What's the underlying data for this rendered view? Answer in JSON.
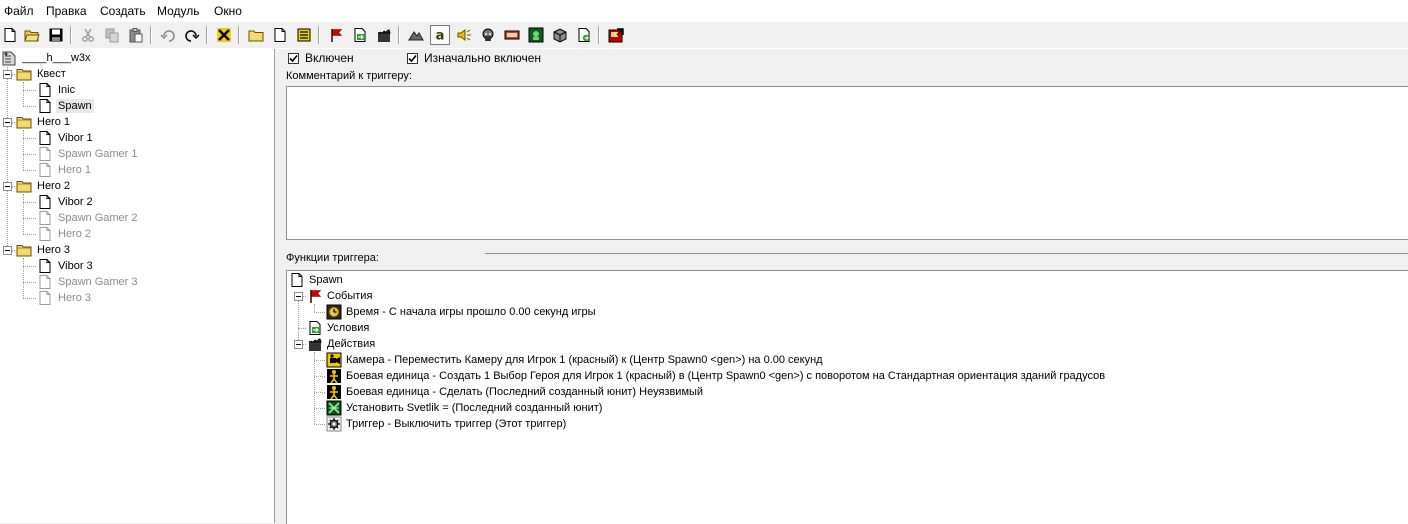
{
  "menu": [
    "Файл",
    "Правка",
    "Создать",
    "Модуль",
    "Окно"
  ],
  "toolbar": {
    "buttons": [
      "new-file-icon",
      "open-folder-icon",
      "save-icon",
      "cut-icon",
      "copy-icon",
      "paste-icon",
      "undo-icon",
      "redo-icon",
      "delete-icon",
      "new-category-icon",
      "new-trigger-icon",
      "new-comment-icon",
      "new-event-icon",
      "new-condition-icon",
      "new-action-icon",
      "terrain-editor-icon",
      "trigger-editor-icon",
      "sound-editor-icon",
      "object-editor-icon",
      "campaign-editor-icon",
      "ai-editor-icon",
      "import-manager-icon",
      "export-map-icon",
      "test-map-icon"
    ],
    "pressed": "trigger-editor-icon"
  },
  "tree": {
    "root": "____h___w3x",
    "categories": [
      {
        "name": "Квест",
        "items": [
          {
            "label": "Inic",
            "enabled": true
          },
          {
            "label": "Spawn",
            "enabled": true,
            "selected": true
          }
        ]
      },
      {
        "name": "Hero 1",
        "items": [
          {
            "label": "Vibor 1",
            "enabled": true
          },
          {
            "label": "Spawn Gamer 1",
            "enabled": false
          },
          {
            "label": "Hero 1",
            "enabled": false
          }
        ]
      },
      {
        "name": "Hero 2",
        "items": [
          {
            "label": "Vibor 2",
            "enabled": true
          },
          {
            "label": "Spawn Gamer 2",
            "enabled": false
          },
          {
            "label": "Hero 2",
            "enabled": false
          }
        ]
      },
      {
        "name": "Hero 3",
        "items": [
          {
            "label": "Vibor 3",
            "enabled": true
          },
          {
            "label": "Spawn Gamer 3",
            "enabled": false
          },
          {
            "label": "Hero 3",
            "enabled": false
          }
        ]
      }
    ]
  },
  "panel": {
    "enabled_label": "Включен",
    "enabled_checked": true,
    "initially_label": "Изначально включен",
    "initially_checked": true,
    "comment_label": "Комментарий к триггеру:",
    "comment_value": "",
    "functions_label": "Функции триггера:"
  },
  "functions": {
    "trigger_name": "Spawn",
    "events_label": "События",
    "events": [
      {
        "icon": "clock-icon",
        "text": "Время - С начала игры прошло 0.00 секунд игры"
      }
    ],
    "conditions_label": "Условия",
    "actions_label": "Действия",
    "actions": [
      {
        "icon": "camera-icon",
        "text": "Камера - Переместить Камеру для Игрок 1 (красный) к (Центр Spawn0 <gen>) на 0.00 секунд"
      },
      {
        "icon": "unit-icon",
        "text": "Боевая единица - Создать 1 Выбор Героя для Игрок 1 (красный) в (Центр Spawn0 <gen>) с поворотом на Стандартная ориентация зданий градусов"
      },
      {
        "icon": "unit-icon",
        "text": "Боевая единица - Сделать (Последний созданный юнит) Неуязвимый"
      },
      {
        "icon": "set-variable-icon",
        "text": "Установить Svetlik = (Последний созданный юнит)"
      },
      {
        "icon": "gear-icon",
        "text": "Триггер - Выключить триггер (Этот триггер)"
      }
    ]
  }
}
